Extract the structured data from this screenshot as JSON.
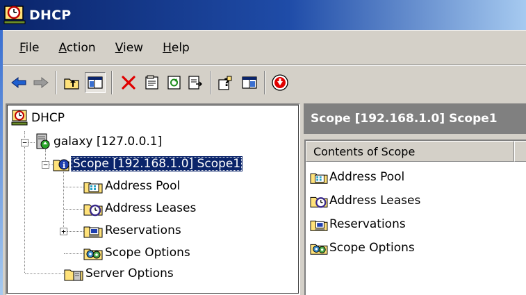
{
  "window": {
    "title": "DHCP"
  },
  "menu": [
    {
      "label_ul": "F",
      "label_rest": "ile"
    },
    {
      "label_ul": "A",
      "label_rest": "ction"
    },
    {
      "label_ul": "V",
      "label_rest": "iew"
    },
    {
      "label_ul": "H",
      "label_rest": "elp"
    }
  ],
  "toolbar": {
    "buttons": [
      "back-icon",
      "forward-icon",
      "up-level-icon",
      "show-hide-tree-icon",
      "delete-icon",
      "properties-icon",
      "refresh-icon",
      "export-list-icon",
      "help-icon",
      "show-hide-action-pane-icon",
      "deactivate-icon"
    ]
  },
  "tree": {
    "root": "DHCP",
    "server": "galaxy [127.0.0.1]",
    "scope": "Scope [192.168.1.0] Scope1",
    "address_pool": "Address Pool",
    "address_leases": "Address Leases",
    "reservations": "Reservations",
    "scope_options": "Scope Options",
    "server_options": "Server Options",
    "expand_minus": "−",
    "expand_plus": "+"
  },
  "result": {
    "header": "Scope [192.168.1.0] Scope1",
    "column": "Contents of Scope",
    "items": [
      "Address Pool",
      "Address Leases",
      "Reservations",
      "Scope Options"
    ]
  },
  "colors": {
    "title_start": "#0a246a",
    "title_end": "#a6caf0",
    "selection": "#0a246a",
    "face": "#d4d0c8"
  }
}
